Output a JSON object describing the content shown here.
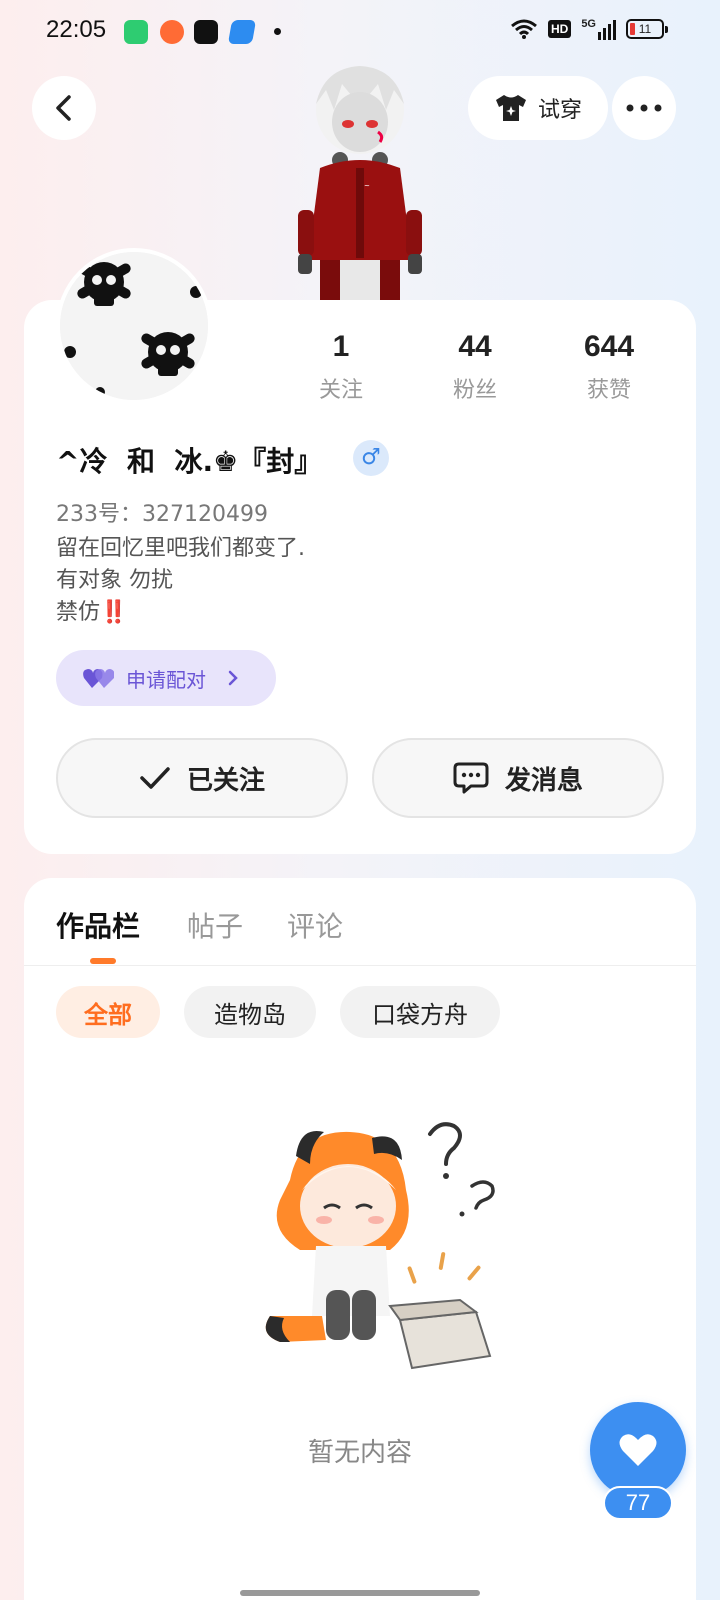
{
  "status_bar": {
    "time": "22:05",
    "hd_label": "HD",
    "network_label": "5G",
    "battery_level": "11"
  },
  "top_bar": {
    "back_icon": "chevron-left-icon",
    "tryon_label": "试穿",
    "more_icon": "more-dots-icon"
  },
  "profile": {
    "stats": [
      {
        "value": "1",
        "label": "关注"
      },
      {
        "value": "44",
        "label": "粉丝"
      },
      {
        "value": "644",
        "label": "获赞"
      }
    ],
    "nickname": "^冷  和  冰.♚『封』",
    "gender_symbol": "♂",
    "uid": "233号：327120499",
    "bio_lines": [
      "留在回忆里吧我们都变了.",
      "有对象 勿扰",
      "禁仿"
    ],
    "bio_warning": "‼️",
    "match_label": "申请配对",
    "follow_label": "已关注",
    "message_label": "发消息"
  },
  "works": {
    "tabs": [
      "作品栏",
      "帖子",
      "评论"
    ],
    "filters": [
      "全部",
      "造物岛",
      "口袋方舟"
    ],
    "empty_text": "暂无内容"
  },
  "like_fab": {
    "count": "77"
  },
  "colors": {
    "accent_orange": "#ff7a2a",
    "accent_blue": "#3d8ff1",
    "accent_purple": "#6a55d6"
  }
}
